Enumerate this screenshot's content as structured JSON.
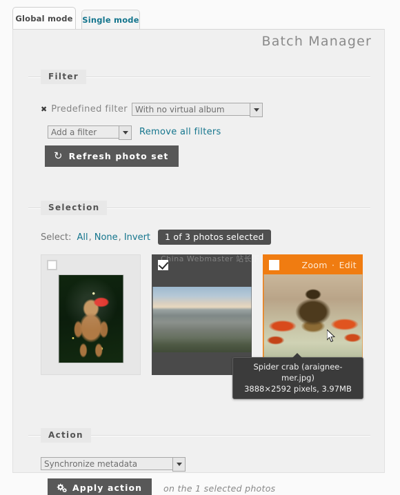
{
  "tabs": [
    {
      "label": "Global mode",
      "active": true
    },
    {
      "label": "Single mode",
      "active": false
    }
  ],
  "page_title": "Batch Manager",
  "filter": {
    "legend": "Filter",
    "remove_icon": "✖",
    "predefined_label": "Predefined filter",
    "predefined_value": "With no virtual album",
    "add_filter_value": "Add a filter",
    "remove_all_label": "Remove all filters",
    "refresh_icon": "↻",
    "refresh_label": "Refresh photo set"
  },
  "selection": {
    "legend": "Selection",
    "select_label": "Select:",
    "all_label": "All",
    "comma1": ",",
    "none_label": "None",
    "comma2": ",",
    "invert_label": "Invert",
    "count_badge": "1 of 3 photos selected",
    "thumbnails": [
      {
        "name": "christmas-teddy-bear",
        "checked": false,
        "state": "normal",
        "watermark": "",
        "zoom_label": "",
        "separator": "",
        "edit_label": ""
      },
      {
        "name": "rock-cairns-landscape",
        "checked": true,
        "state": "selected",
        "watermark": "China Webmaster 站长下载",
        "zoom_label": "",
        "separator": "",
        "edit_label": ""
      },
      {
        "name": "spider-crab",
        "checked": false,
        "state": "hover",
        "watermark": "",
        "zoom_label": "Zoom",
        "separator": "·",
        "edit_label": "Edit"
      }
    ],
    "tooltip": {
      "line1": "Spider crab (araignee-mer.jpg)",
      "line2": "3888×2592 pixels, 3.97MB"
    }
  },
  "action": {
    "legend": "Action",
    "selected_action": "Synchronize metadata",
    "apply_icon": "gears-icon",
    "apply_label": "Apply action",
    "apply_note": "on the 1 selected photos"
  },
  "colors": {
    "accent_link": "#14758d",
    "hover_highlight": "#f07c11",
    "selected_dark": "#4a4a4a",
    "button_dark": "#585858",
    "panel_bg": "#f0f0f0"
  }
}
